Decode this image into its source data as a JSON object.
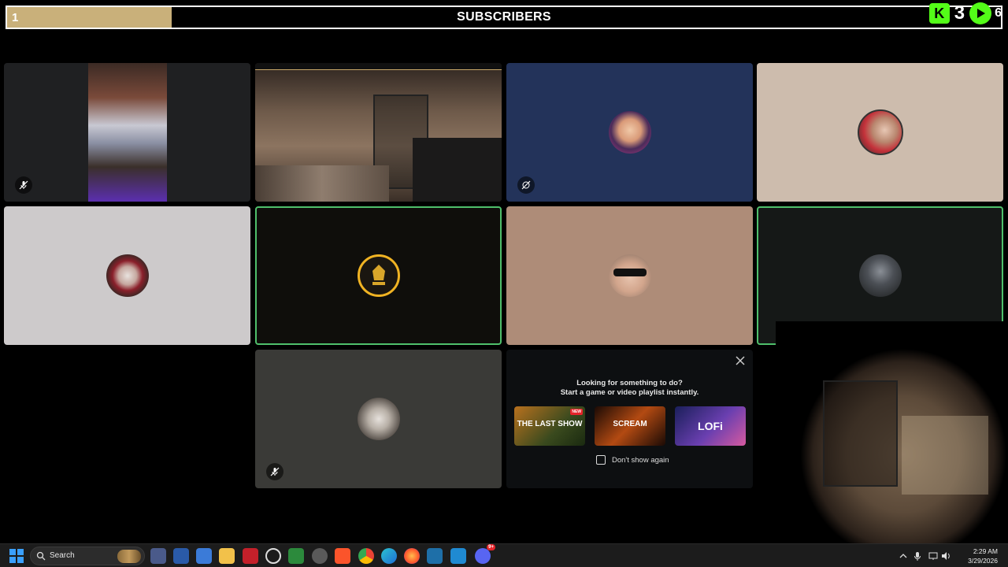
{
  "header": {
    "subscriber_count": "1",
    "title": "SUBSCRIBERS",
    "progress_fraction": 0.166,
    "overlay_count_left": "3",
    "overlay_count_right": "6"
  },
  "tiles": [
    {
      "name": "tile-street-video",
      "muted": true
    },
    {
      "name": "tile-bedroom-cam",
      "muted": false
    },
    {
      "name": "tile-user-austin",
      "muted": true
    },
    {
      "name": "tile-user-mario",
      "muted": false
    },
    {
      "name": "tile-user-joker",
      "muted": false
    },
    {
      "name": "tile-user-gold-logo",
      "muted": false,
      "speaking": true
    },
    {
      "name": "tile-user-sunglasses",
      "muted": false
    },
    {
      "name": "tile-user-dark",
      "muted": false,
      "speaking": true
    },
    {
      "name": "tile-user-old-man",
      "muted": true
    }
  ],
  "activity": {
    "line1": "Looking for something to do?",
    "line2": "Start a game or video playlist instantly.",
    "cards": [
      {
        "label": "THE LAST SHOW",
        "new_badge": "NEW"
      },
      {
        "label": "SCREAM"
      },
      {
        "label": "LOFi"
      }
    ],
    "dont_show_label": "Don't show again"
  },
  "taskbar": {
    "search_label": "Search",
    "time": "2:29 AM",
    "date": "3/29/2026",
    "discord_badge": "9+"
  },
  "colors": {
    "progress_fill": "#c9b07a",
    "speaking_border": "#4fbf6b",
    "kick_green": "#53fc18"
  }
}
